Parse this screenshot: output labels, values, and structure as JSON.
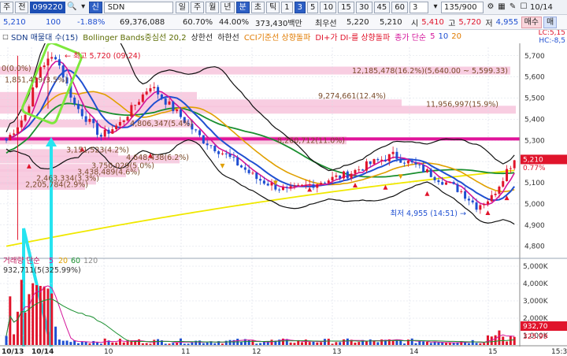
{
  "toolbar": {
    "type_label": "주",
    "range_label": "전",
    "code": "099220",
    "search_icon": "search-icon",
    "credit_label": "신",
    "stock_name": "SDN",
    "periods": [
      "일",
      "주",
      "월",
      "년",
      "분",
      "초",
      "틱"
    ],
    "active_period": "분",
    "minutes": [
      "1",
      "3",
      "5",
      "10",
      "15",
      "30",
      "45",
      "60"
    ],
    "active_minute": "3",
    "interval_value": "3",
    "count_value": "135/900",
    "date_label": "10/14"
  },
  "quote": {
    "price": "5,210",
    "change": "100",
    "change_pct": "-1.88%",
    "volume": "69,376,088",
    "turnover_pct": "60.70%",
    "strength": "44.00%",
    "amount": "373,430백만",
    "best_label": "최우선",
    "best_ask": "5,220",
    "best_bid": "5,210",
    "open_label": "시",
    "open": "5,410",
    "high_label": "고",
    "high": "5,720",
    "low_label": "저",
    "low": "4,955",
    "buy_label": "매수",
    "sell_label": "매"
  },
  "legend": {
    "title": "SDN 매물대 수(15)",
    "bollinger": "Bollinger Bands중심선 20,2",
    "upper": "상한선",
    "lower": "하한선",
    "cci": "CCI기준선 상향돌파",
    "dmi": "DI+가 DI-를 상향돌파",
    "ma_title": "종가 단순",
    "ma5": "5",
    "ma10": "10",
    "ma20": "20",
    "lc": "LC:5,15",
    "hc": "HC:-8,5"
  },
  "price_axis": [
    "5,700",
    "5,600",
    "5,500",
    "5,400",
    "5,300",
    "5,200",
    "5,100",
    "5,000",
    "4,900",
    "4,800"
  ],
  "current_price_tag": "5,210",
  "current_pct_tag": "0.77%",
  "annotations": {
    "high": "최고 5,720 (09:24)",
    "low": "최저 4,955 (14:51)"
  },
  "profile_labels": [
    "0(0.0%)",
    "1,851,419(3.5%)",
    "12,185,478(16.2%)(5,640.00 ~ 5,599.33)",
    "9,274,661(12.4%)",
    "11,956,997(15.9%)",
    "4,806,347(5.4%)",
    "8,260,712(11.0%)",
    "3,151,523(4.2%)",
    "4,648,438(6.2%)",
    "3,750,029(5.0%)",
    "3,438,489(4.6%)",
    "2,463,334(3.3%)",
    "2,205,784(2.9%)"
  ],
  "volume_panel": {
    "title": "거래량 단순",
    "ma5": "5",
    "ma20": "20",
    "ma60": "60",
    "ma120": "120",
    "first_value": "932,711(5(325.99%)",
    "axis": [
      "5,000K",
      "4,000K",
      "3,000K",
      "2,000K",
      "1,000K"
    ],
    "tag_value": "932,70",
    "tag_pct": "325.99"
  },
  "time_axis": [
    "10/13",
    "10/14",
    "10",
    "11",
    "12",
    "13",
    "14",
    "15",
    "15:30"
  ],
  "colors": {
    "up": "#e0142b",
    "down": "#1f4fd1",
    "ma5": "#d4149a",
    "ma10": "#1f4fd1",
    "ma20": "#e0a000",
    "ma60": "#1a8f2f",
    "ma120": "#f0e800",
    "band": "#111111",
    "overlay": "#7ee83c",
    "cyan": "#27e4f0",
    "hline": "#e0149a",
    "profile": "#f7c4dc"
  },
  "chart_data": {
    "type": "candlestick",
    "title": "SDN",
    "interval": "3분",
    "ylim": [
      4780,
      5740
    ],
    "x": [
      "10/14 09:00",
      "10/14 15:30"
    ],
    "open": 5410,
    "high": 5720,
    "low": 4955,
    "close": 5210,
    "profile_volume": [
      {
        "price_band": "5,640.00 ~ 5,599.33",
        "volume": 12185478,
        "pct": 16.2
      },
      {
        "volume": 11956997,
        "pct": 15.9
      },
      {
        "volume": 9274661,
        "pct": 12.4
      },
      {
        "volume": 8260712,
        "pct": 11.0
      },
      {
        "volume": 4806347,
        "pct": 5.4
      },
      {
        "volume": 4648438,
        "pct": 6.2
      },
      {
        "volume": 3750029,
        "pct": 5.0
      },
      {
        "volume": 3438489,
        "pct": 4.6
      },
      {
        "volume": 3151523,
        "pct": 4.2
      },
      {
        "volume": 2463334,
        "pct": 3.3
      },
      {
        "volume": 2205784,
        "pct": 2.9
      },
      {
        "volume": 1851419,
        "pct": 3.5
      },
      {
        "volume": 0,
        "pct": 0.0
      }
    ]
  }
}
